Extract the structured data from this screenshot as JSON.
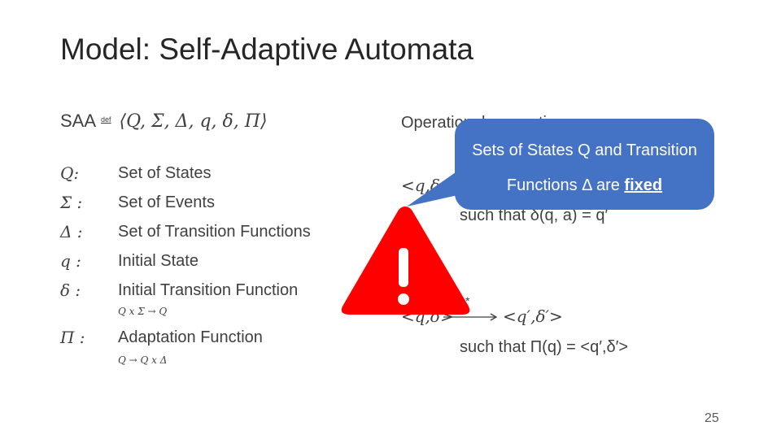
{
  "title": "Model: Self-Adaptive Automata",
  "definition": {
    "name": "SAA",
    "def_symbol": "def",
    "tuple": "⟨Q, Σ, Δ, q, δ, Π⟩"
  },
  "components": [
    {
      "symbol": "Q:",
      "label": "Set of States"
    },
    {
      "symbol": "Σ :",
      "label": "Set of Events"
    },
    {
      "symbol": "Δ :",
      "label": "Set of Transition Functions"
    },
    {
      "symbol": "q :",
      "label": "Initial State"
    },
    {
      "symbol": "δ :",
      "label": "Initial Transition Function",
      "signature": "Q x Σ → Q"
    },
    {
      "symbol": "Π :",
      "label": "Adaptation Function",
      "signature": "Q → Q x Δ"
    }
  ],
  "semantics": {
    "heading": "Operational semantics",
    "rule1_left": "<q,δ>",
    "rule1_cond": "such that δ(q, a) = q′",
    "rule2_left": "<q,δ>",
    "rule2_star": "*",
    "rule2_right": "<q′,δ′>",
    "rule2_cond": "such that Π(q) = <q′,δ′>"
  },
  "callout": {
    "line1": "Sets of States Q and Transition",
    "line2": "Functions Δ are ",
    "emph": "fixed",
    "color": "#4472c4"
  },
  "warning": {
    "icon": "warning-triangle-icon",
    "color": "#ff0000"
  },
  "page_number": "25"
}
